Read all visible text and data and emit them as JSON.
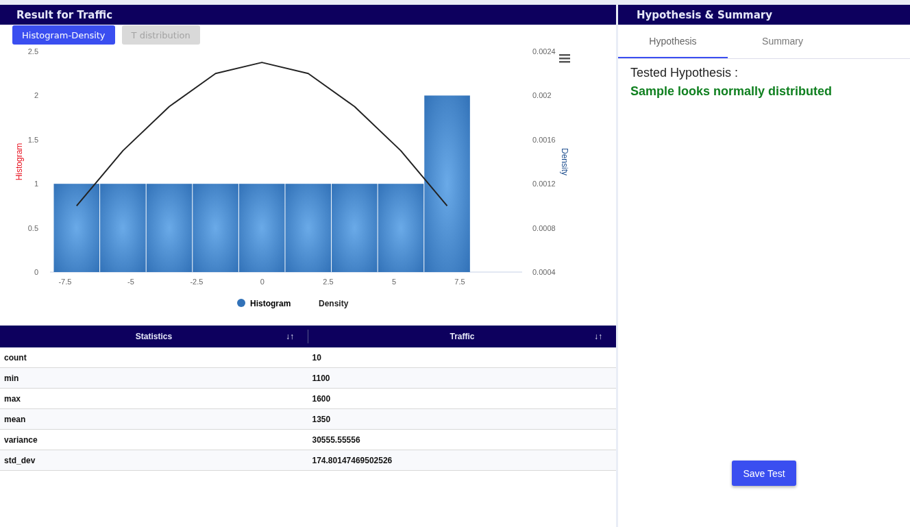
{
  "result_panel": {
    "title": "Result for  Traffic",
    "chart_tabs": [
      {
        "label": "Histogram-Density",
        "selected": true
      },
      {
        "label": "T distribution",
        "selected": false
      }
    ],
    "chart_data": {
      "type": "bar",
      "ylabel": "Histogram",
      "y2label": "Density",
      "x": [
        -7.06,
        -5.3,
        -3.54,
        -1.78,
        -0.02,
        1.74,
        3.5,
        5.26,
        7.02
      ],
      "xlim": [
        -8.07,
        9.87
      ],
      "ylim": [
        0,
        2.5
      ],
      "y2lim": [
        0.0004,
        0.0024
      ],
      "xticks": [
        -7.5,
        -5,
        -2.5,
        0,
        2.5,
        5,
        7.5
      ],
      "yticks": [
        0,
        0.5,
        1,
        1.5,
        2,
        2.5
      ],
      "y2ticks": [
        0.0004,
        0.0008,
        0.0012,
        0.0016,
        0.002,
        0.0024
      ],
      "series": [
        {
          "name": "Histogram",
          "color": "#3272b8",
          "values": [
            1,
            1,
            1,
            1,
            1,
            1,
            1,
            1,
            2
          ]
        },
        {
          "name": "Density",
          "type": "line",
          "color": "#222222",
          "axis": "y2",
          "values": [
            0.001,
            0.0015,
            0.0019,
            0.0022,
            0.0023,
            0.0022,
            0.0019,
            0.0015,
            0.001
          ]
        }
      ]
    },
    "table": {
      "columns": [
        {
          "label": "Statistics",
          "sort_icon": "↓↑"
        },
        {
          "label": "Traffic",
          "sort_icon": "↓↑"
        }
      ],
      "rows": [
        [
          "count",
          "10"
        ],
        [
          "min",
          "1100"
        ],
        [
          "max",
          "1600"
        ],
        [
          "mean",
          "1350"
        ],
        [
          "variance",
          "30555.55556"
        ],
        [
          "std_dev",
          "174.80147469502526"
        ]
      ]
    }
  },
  "summary_panel": {
    "title": "Hypothesis & Summary",
    "tabs": [
      {
        "label": "Hypothesis",
        "selected": true
      },
      {
        "label": "Summary",
        "selected": false
      }
    ],
    "heading": "Tested Hypothesis :",
    "conclusion": "Sample looks normally distributed",
    "save_button": "Save Test"
  }
}
